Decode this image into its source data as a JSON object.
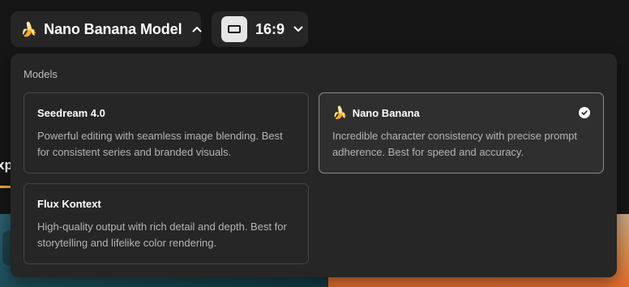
{
  "model_selector": {
    "icon": "banana-icon",
    "label": "Nano Banana Model"
  },
  "ratio_selector": {
    "icon": "aspect-ratio-icon",
    "label": "16:9"
  },
  "background": {
    "tab_text": "xp",
    "accent": "#f2a93b"
  },
  "dropdown": {
    "heading": "Models",
    "models": [
      {
        "name": "Seedream 4.0",
        "description": "Powerful editing with seamless image blending. Best for consistent series and branded visuals.",
        "selected": false
      },
      {
        "name": "Nano Banana",
        "icon": "banana-icon",
        "description": "Incredible character consistency with precise prompt adherence. Best for speed and accuracy.",
        "selected": true
      },
      {
        "name": "Flux Kontext",
        "description": "High-quality output with rich detail and depth. Best for storytelling and lifelike color rendering.",
        "selected": false
      }
    ]
  }
}
